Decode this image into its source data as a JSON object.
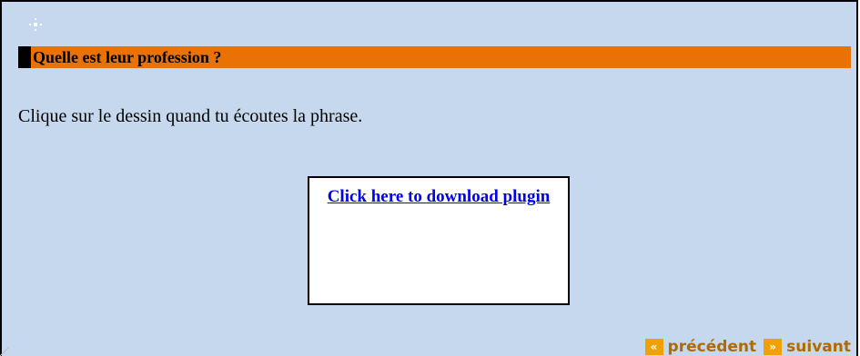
{
  "header": {
    "title": "Quelle est leur profession ?"
  },
  "instruction": "Clique sur le dessin quand tu écoutes la phrase.",
  "plugin": {
    "link_text": "Click here to download plugin"
  },
  "nav": {
    "prev_arrow": "«",
    "prev_label": "précédent",
    "next_arrow": "»",
    "next_label": "suivant"
  },
  "colors": {
    "panel_bg": "#c6d8ee",
    "header_bg": "#ea7205",
    "link": "#0000ee",
    "nav_accent": "#f0a000"
  },
  "icons": {
    "decoration": "sparkle-icon"
  }
}
